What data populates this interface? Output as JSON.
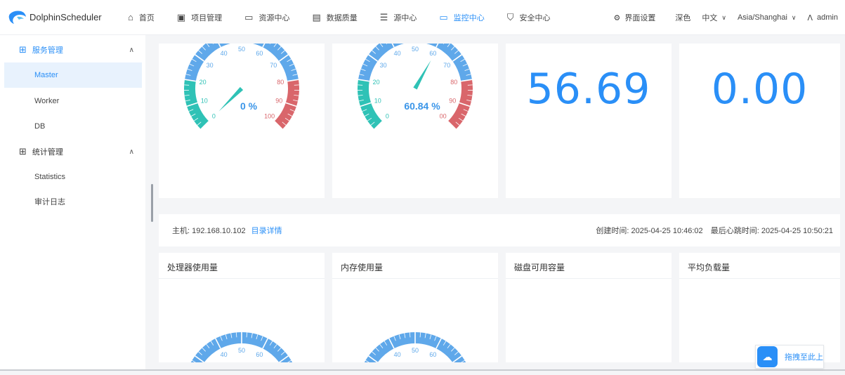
{
  "app": {
    "name": "DolphinScheduler"
  },
  "nav": {
    "items": [
      {
        "label": "首页",
        "icon": "home-icon"
      },
      {
        "label": "项目管理",
        "icon": "project-icon"
      },
      {
        "label": "资源中心",
        "icon": "folder-icon"
      },
      {
        "label": "数据质量",
        "icon": "document-icon"
      },
      {
        "label": "源中心",
        "icon": "datasource-icon"
      },
      {
        "label": "监控中心",
        "icon": "monitor-icon",
        "active": true
      },
      {
        "label": "安全中心",
        "icon": "shield-icon"
      }
    ],
    "ui_settings": "界面设置",
    "theme": "深色",
    "language": "中文",
    "timezone": "Asia/Shanghai",
    "user": "admin"
  },
  "sidebar": {
    "groups": [
      {
        "label": "服务管理",
        "items": [
          "Master",
          "Worker",
          "DB"
        ]
      },
      {
        "label": "统计管理",
        "items": [
          "Statistics",
          "审计日志"
        ]
      }
    ],
    "active_item": "Master"
  },
  "gauges": [
    {
      "ticks": [
        "0",
        "10",
        "20",
        "30",
        "40",
        "50",
        "60",
        "70",
        "80",
        "90",
        "100"
      ],
      "value": 0,
      "display": "0 %"
    },
    {
      "ticks": [
        "0",
        "10",
        "20",
        "30",
        "40",
        "50",
        "60",
        "70",
        "80",
        "90",
        "00"
      ],
      "value": 60.84,
      "display": "60.84 %"
    }
  ],
  "metrics": [
    {
      "value": "56.69"
    },
    {
      "value": "0.00"
    }
  ],
  "host": {
    "host_label": "主机: 192.168.10.102",
    "link": "目录详情",
    "created": "创建时间: 2025-04-25 10:46:02",
    "heartbeat": "最后心跳时间: 2025-04-25 10:50:21"
  },
  "panels": [
    {
      "title": "处理器使用量"
    },
    {
      "title": "内存使用量"
    },
    {
      "title": "磁盘可用容量"
    },
    {
      "title": "平均负载量"
    }
  ],
  "partial_gauges": [
    {
      "ticks": [
        "40",
        "50",
        "60"
      ]
    },
    {
      "ticks": [
        "40",
        "50",
        "60"
      ]
    }
  ],
  "drag_button": {
    "label": "拖拽至此上"
  },
  "colors": {
    "accent": "#2a8ff7",
    "gauge_blue": "#5fa8ea",
    "gauge_teal": "#2fc2b6",
    "gauge_red": "#d9666b"
  }
}
